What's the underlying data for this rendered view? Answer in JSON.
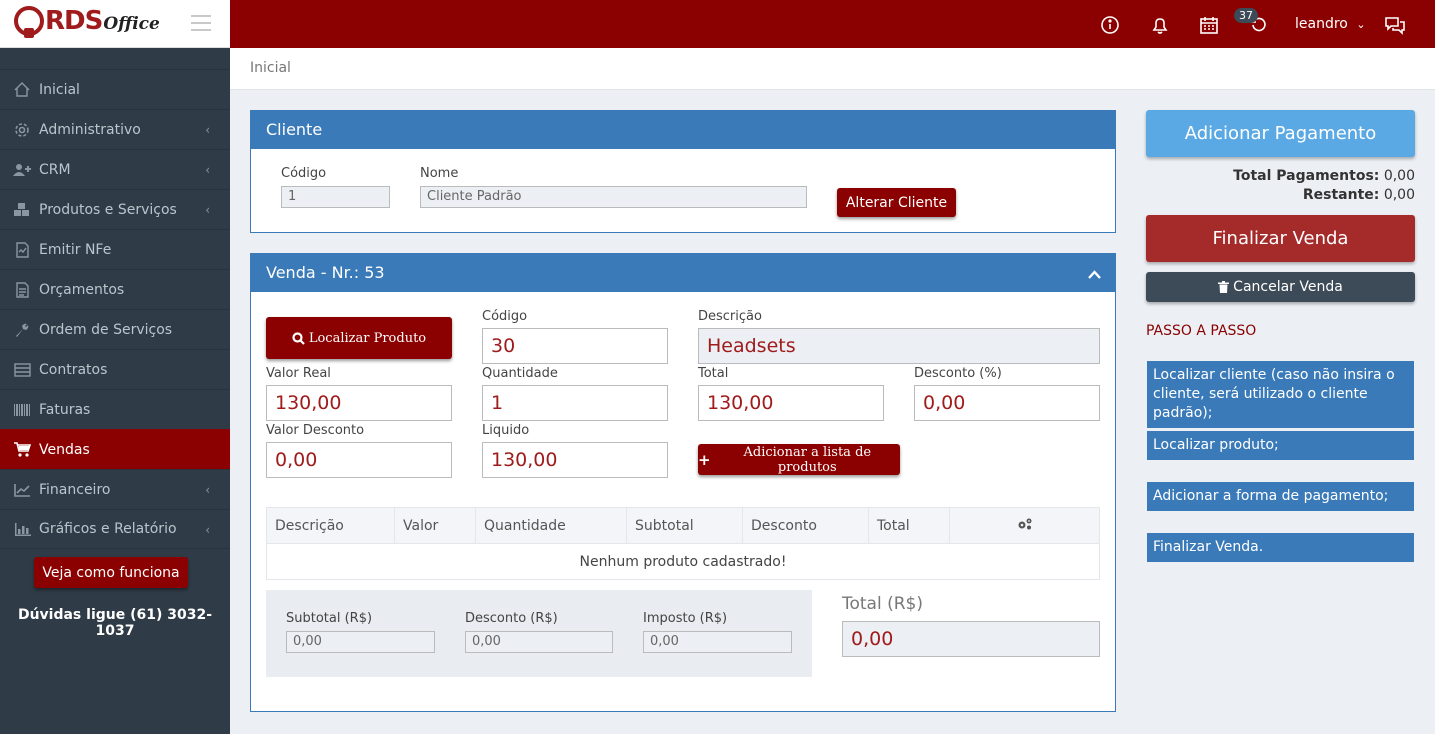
{
  "logo": {
    "text_rds": "RDS",
    "text_office": "Office"
  },
  "sidebar": {
    "items": [
      {
        "label": "Inicial",
        "icon": "home-icon",
        "chevron": false
      },
      {
        "label": "Administrativo",
        "icon": "gear-icon",
        "chevron": true
      },
      {
        "label": "CRM",
        "icon": "users-icon",
        "chevron": true
      },
      {
        "label": "Produtos e Serviços",
        "icon": "cubes-icon",
        "chevron": true
      },
      {
        "label": "Emitir NFe",
        "icon": "document-icon",
        "chevron": false
      },
      {
        "label": "Orçamentos",
        "icon": "file-text-icon",
        "chevron": false
      },
      {
        "label": "Ordem de Serviços",
        "icon": "wrench-icon",
        "chevron": false
      },
      {
        "label": "Contratos",
        "icon": "list-icon",
        "chevron": false
      },
      {
        "label": "Faturas",
        "icon": "barcode-icon",
        "chevron": false
      },
      {
        "label": "Vendas",
        "icon": "cart-icon",
        "chevron": false,
        "active": true
      },
      {
        "label": "Financeiro",
        "icon": "line-chart-icon",
        "chevron": true
      },
      {
        "label": "Gráficos e Relatório",
        "icon": "bar-chart-icon",
        "chevron": true
      }
    ],
    "help_button": "Veja como funciona",
    "phone_text": "Dúvidas ligue (61) 3032-1037"
  },
  "topbar": {
    "badge": "37",
    "user": "leandro"
  },
  "breadcrumb": "Inicial",
  "cliente": {
    "title": "Cliente",
    "codigo_label": "Código",
    "codigo_value": "1",
    "nome_label": "Nome",
    "nome_value": "Cliente Padrão",
    "alterar_button": "Alterar Cliente"
  },
  "venda": {
    "title": "Venda - Nr.: 53",
    "localizar_button": "Localizar Produto",
    "codigo_label": "Código",
    "codigo_value": "30",
    "descricao_label": "Descrição",
    "descricao_value": "Headsets",
    "valor_real_label": "Valor Real",
    "valor_real_value": "130,00",
    "quantidade_label": "Quantidade",
    "quantidade_value": "1",
    "total_label": "Total",
    "total_value": "130,00",
    "desconto_pct_label": "Desconto (%)",
    "desconto_pct_value": "0,00",
    "valor_desconto_label": "Valor Desconto",
    "valor_desconto_value": "0,00",
    "liquido_label": "Liquido",
    "liquido_value": "130,00",
    "adicionar_button": "Adicionar a lista de produtos",
    "table": {
      "headers": [
        "Descrição",
        "Valor",
        "Quantidade",
        "Subtotal",
        "Desconto",
        "Total"
      ],
      "empty_message": "Nenhum produto cadastrado!"
    },
    "subtotal_label": "Subtotal (R$)",
    "subtotal_value": "0,00",
    "desconto_label": "Desconto (R$)",
    "desconto_value": "0,00",
    "imposto_label": "Imposto (R$)",
    "imposto_value": "0,00",
    "total_rs_label": "Total (R$)",
    "total_rs_value": "0,00"
  },
  "right": {
    "adicionar_pagamento": "Adicionar Pagamento",
    "total_pagamentos_label": "Total Pagamentos:",
    "total_pagamentos_value": "0,00",
    "restante_label": "Restante:",
    "restante_value": "0,00",
    "finalizar_button": "Finalizar Venda",
    "cancelar_button": "Cancelar Venda",
    "passo_title": "PASSO A PASSO",
    "steps": [
      "Localizar cliente (caso não insira o cliente, será utilizado o cliente padrão);",
      "Localizar produto;",
      "Adicionar a forma de pagamento;",
      "Finalizar Venda."
    ]
  },
  "colors": {
    "brand_red": "#8b0000",
    "panel_blue": "#3a7ab8",
    "sidebar_bg": "#2f3b46",
    "light_blue_button": "#5aa9e4"
  }
}
